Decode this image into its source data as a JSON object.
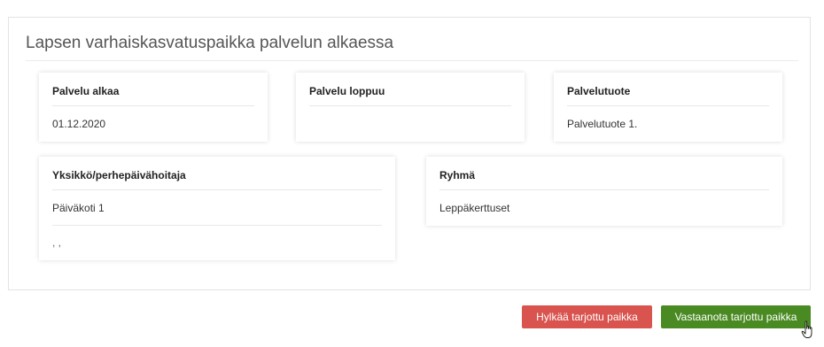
{
  "section": {
    "title": "Lapsen varhaiskasvatuspaikka palvelun alkaessa"
  },
  "cards": {
    "service_start": {
      "label": "Palvelu alkaa",
      "value": "01.12.2020"
    },
    "service_end": {
      "label": "Palvelu loppuu",
      "value": ""
    },
    "service_product": {
      "label": "Palvelutuote",
      "value": "Palvelutuote 1."
    },
    "unit": {
      "label": "Yksikkö/perhepäivähoitaja",
      "value": "Päiväkoti 1",
      "address": ", ,"
    },
    "group": {
      "label": "Ryhmä",
      "value": "Leppäkerttuset"
    }
  },
  "actions": {
    "reject_label": "Hylkää tarjottu paikka",
    "accept_label": "Vastaanota tarjottu paikka",
    "reject_color": "#d9534f",
    "accept_color": "#4a8a22"
  },
  "icons": {
    "cursor": "hand-pointer-cursor-icon"
  }
}
